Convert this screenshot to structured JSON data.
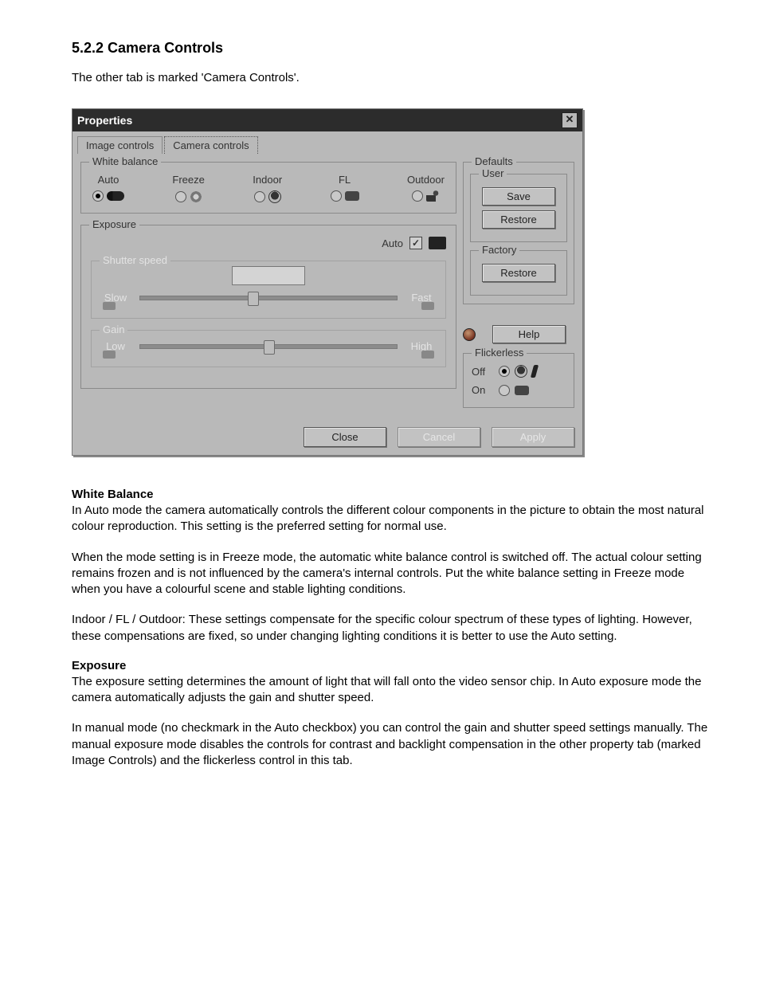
{
  "doc": {
    "heading": "5.2.2 Camera Controls",
    "intro": "The other tab is marked 'Camera Controls'."
  },
  "dialog": {
    "title": "Properties",
    "close_glyph": "✕",
    "tabs": {
      "image": "Image controls",
      "camera": "Camera controls"
    },
    "white_balance": {
      "legend": "White balance",
      "options": {
        "auto": "Auto",
        "freeze": "Freeze",
        "indoor": "Indoor",
        "fl": "FL",
        "outdoor": "Outdoor"
      },
      "selected": "auto"
    },
    "exposure": {
      "legend": "Exposure",
      "auto_label": "Auto",
      "auto_checked": true,
      "shutter": {
        "legend": "Shutter speed",
        "low_label": "Slow",
        "high_label": "Fast",
        "value_percent": 42
      },
      "gain": {
        "legend": "Gain",
        "low_label": "Low",
        "high_label": "High",
        "value_percent": 48
      }
    },
    "defaults": {
      "legend": "Defaults",
      "user": {
        "legend": "User",
        "save": "Save",
        "restore": "Restore"
      },
      "factory": {
        "legend": "Factory",
        "restore": "Restore"
      }
    },
    "help_label": "Help",
    "flickerless": {
      "legend": "Flickerless",
      "off_label": "Off",
      "on_label": "On",
      "selected": "off"
    },
    "buttons": {
      "close": "Close",
      "cancel": "Cancel",
      "apply": "Apply"
    }
  },
  "text": {
    "wb_head": "White Balance",
    "wb_p1": "In Auto mode the camera automatically controls the different colour components in the picture to obtain the most natural colour reproduction. This setting is the preferred setting for normal use.",
    "wb_p2": "When the mode setting is in Freeze mode, the automatic white balance control is switched off. The actual colour setting remains frozen and is not influenced by the camera's internal controls. Put the white balance setting in Freeze mode when you have a colourful scene and stable lighting conditions.",
    "wb_p3": "Indoor / FL / Outdoor: These settings compensate for the specific colour spectrum of these types of lighting. However, these compensations are fixed, so under changing lighting conditions it is better to use the Auto setting.",
    "ex_head": "Exposure",
    "ex_p1": "The exposure setting determines the amount of light that will fall onto the video sensor chip. In Auto exposure mode the camera automatically adjusts the gain and shutter speed.",
    "ex_p2": "In manual mode (no checkmark in the Auto checkbox) you can control the gain and shutter speed settings manually. The manual exposure mode disables the controls for contrast and backlight compensation in the other property tab (marked Image Controls) and the flickerless control in this tab."
  }
}
